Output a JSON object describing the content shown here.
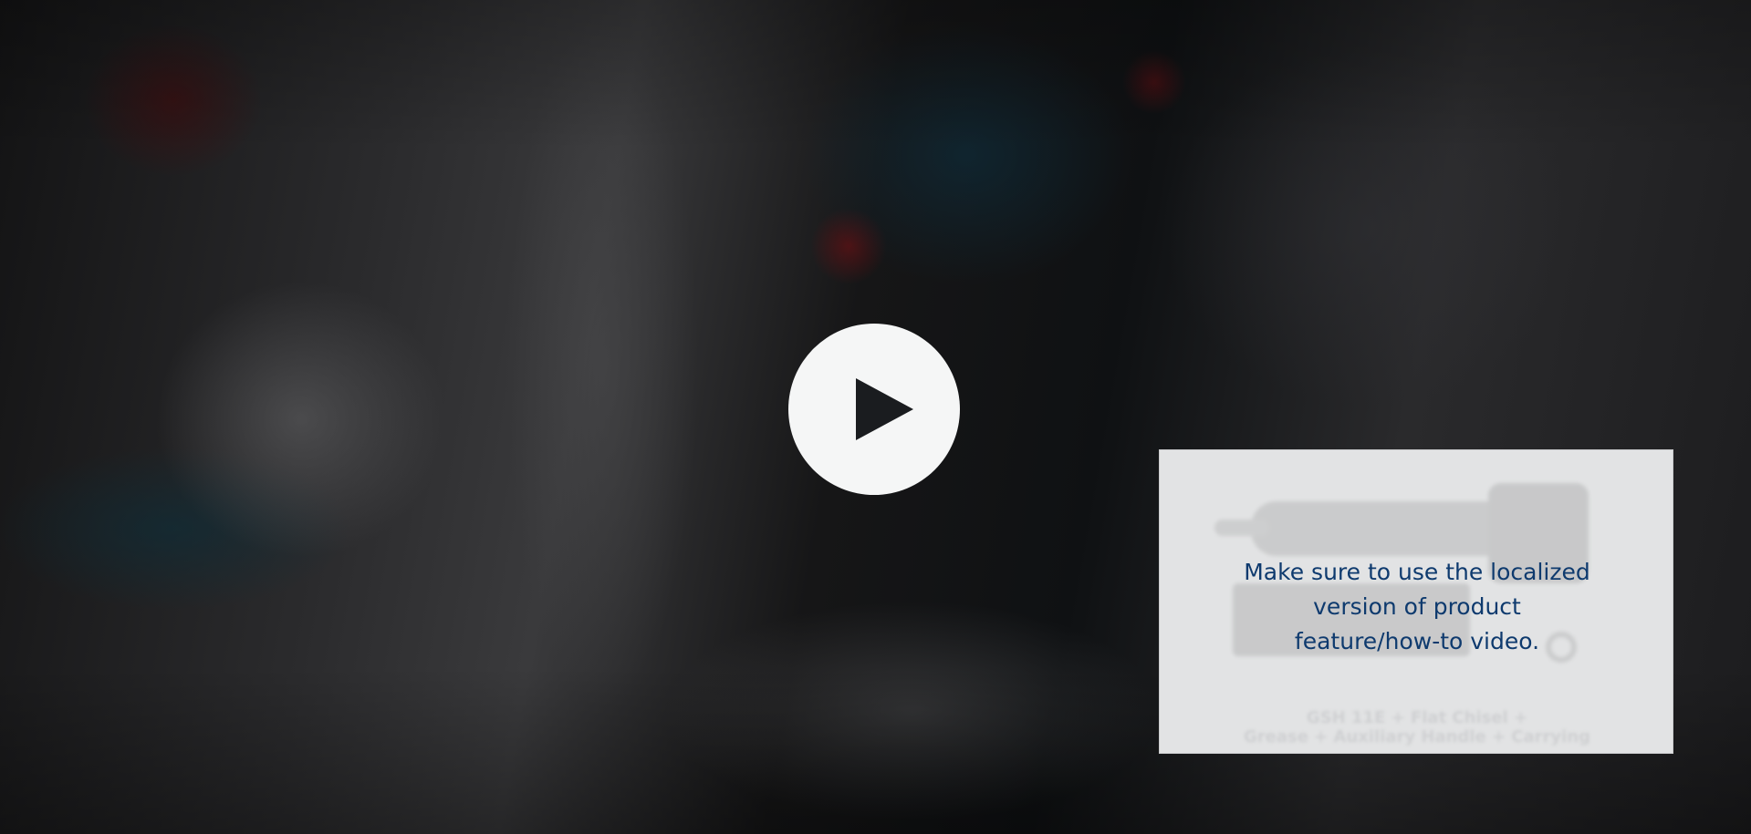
{
  "video": {
    "play_label": "Play",
    "play_icon": "play-icon"
  },
  "notice": {
    "lines": [
      "Make sure to use the localized",
      "version of product",
      "feature/how-to video."
    ],
    "caption_lines": [
      "GSH 11E + Flat Chisel +",
      "Grease + Auxiliary Handle + Carrying"
    ]
  },
  "colors": {
    "notice_text": "#0e3a6e",
    "play_button": "#f5f6f6",
    "play_glyph": "#1a1c1f",
    "card_background": "#e2e3e4"
  }
}
